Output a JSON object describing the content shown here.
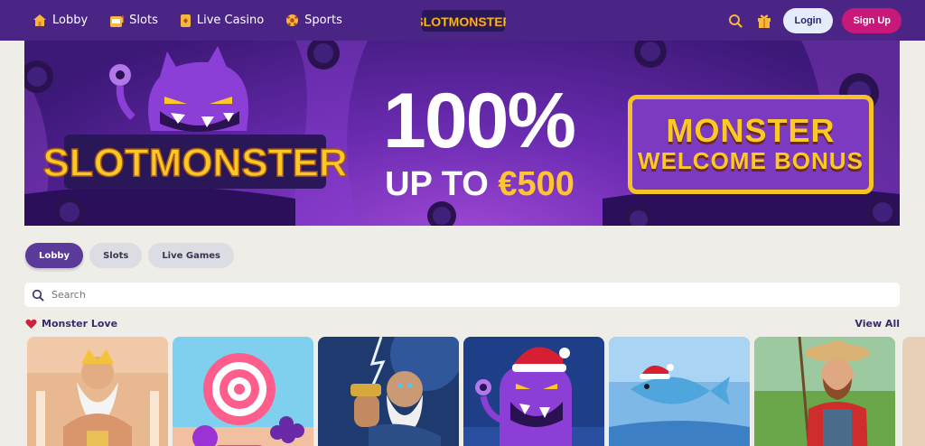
{
  "nav": {
    "items": [
      {
        "label": "Lobby",
        "icon": "home-icon"
      },
      {
        "label": "Slots",
        "icon": "slot-machine-icon"
      },
      {
        "label": "Live Casino",
        "icon": "cards-icon"
      },
      {
        "label": "Sports",
        "icon": "ball-icon"
      }
    ],
    "logo_text": "SLOTMONSTER",
    "login_label": "Login",
    "signup_label": "Sign Up"
  },
  "banner": {
    "logo_text": "SLOTMONSTER",
    "headline": "100%",
    "subline_prefix": "UP TO ",
    "subline_amount": "€500",
    "bonus_line1": "MONSTER",
    "bonus_line2": "WELCOME BONUS"
  },
  "tabs": [
    {
      "label": "Lobby",
      "active": true
    },
    {
      "label": "Slots",
      "active": false
    },
    {
      "label": "Live Games",
      "active": false
    }
  ],
  "search": {
    "placeholder": "Search"
  },
  "section": {
    "title": "Monster Love",
    "view_all": "View All"
  },
  "games": [
    {
      "icon": "zeus-temple-game"
    },
    {
      "icon": "sweet-candy-game"
    },
    {
      "icon": "zeus-lightning-game"
    },
    {
      "icon": "monster-santa-game"
    },
    {
      "icon": "fish-santa-game"
    },
    {
      "icon": "fisherman-game"
    }
  ],
  "colors": {
    "nav_bg": "#4a2585",
    "accent_yellow": "#fcc826",
    "signup": "#c8197a",
    "page_bg": "#eeede8"
  }
}
